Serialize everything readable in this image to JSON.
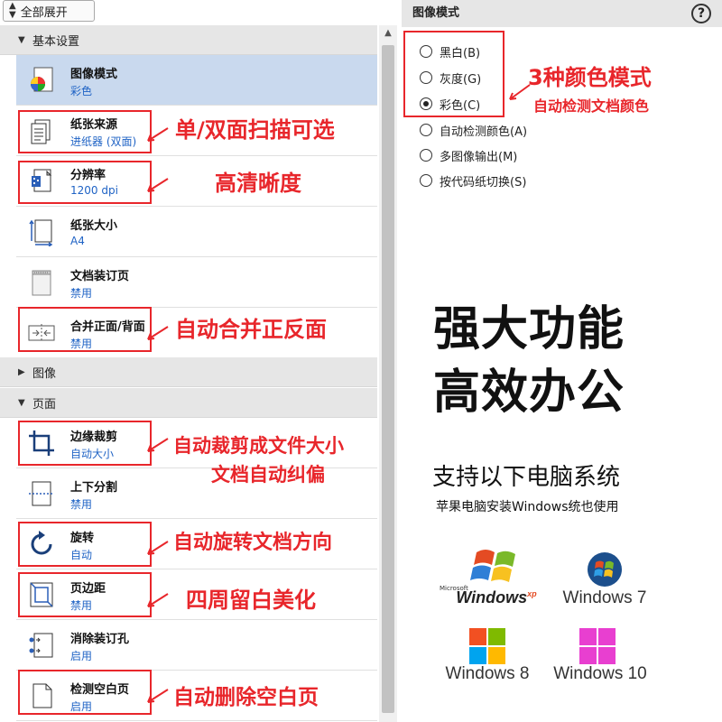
{
  "toolbar": {
    "expand_all": "全部展开"
  },
  "sections": {
    "basic": "基本设置",
    "image": "图像",
    "page": "页面"
  },
  "items": [
    {
      "name": "图像模式",
      "value": "彩色",
      "icon": "color-wheel-icon"
    },
    {
      "name": "纸张来源",
      "value": "进纸器 (双面)",
      "icon": "paper-source-icon"
    },
    {
      "name": "分辨率",
      "value": "1200 dpi",
      "icon": "resolution-icon"
    },
    {
      "name": "纸张大小",
      "value": "A4",
      "icon": "paper-size-icon"
    },
    {
      "name": "文档装订页",
      "value": "禁用",
      "icon": "binding-page-icon"
    },
    {
      "name": "合并正面/背面",
      "value": "禁用",
      "icon": "merge-sides-icon"
    },
    {
      "name": "边缘裁剪",
      "value": "自动大小",
      "icon": "crop-icon"
    },
    {
      "name": "上下分割",
      "value": "禁用",
      "icon": "split-icon"
    },
    {
      "name": "旋转",
      "value": "自动",
      "icon": "rotate-icon"
    },
    {
      "name": "页边距",
      "value": "禁用",
      "icon": "margin-icon"
    },
    {
      "name": "消除装订孔",
      "value": "启用",
      "icon": "punch-hole-icon"
    },
    {
      "name": "检测空白页",
      "value": "启用",
      "icon": "blank-page-icon"
    }
  ],
  "annotations": {
    "duplex": "单/双面扫描可选",
    "hd": "高清晰度",
    "merge": "自动合并正反面",
    "crop1": "自动裁剪成文件大小",
    "crop2": "文档自动纠偏",
    "rotate": "自动旋转文档方向",
    "margin": "四周留白美化",
    "blank": "自动删除空白页",
    "modes": "3种颜色模式",
    "detect": "自动检测文档颜色"
  },
  "right_panel": {
    "title": "图像模式",
    "help": "?",
    "options": [
      {
        "label": "黑白(B)",
        "selected": false
      },
      {
        "label": "灰度(G)",
        "selected": false
      },
      {
        "label": "彩色(C)",
        "selected": true
      },
      {
        "label": "自动检测颜色(A)",
        "selected": false
      },
      {
        "label": "多图像输出(M)",
        "selected": false
      },
      {
        "label": "按代码纸切换(S)",
        "selected": false
      }
    ]
  },
  "promo": {
    "line1": "强大功能",
    "line2": "高效办公",
    "support": "支持以下电脑系统",
    "note": "苹果电脑安装Windows统也使用"
  },
  "os": {
    "xp": "Windows",
    "xp_sup": "xp",
    "xp_small": "Microsoft",
    "w7": "Windows 7",
    "w8": "Windows 8",
    "w10": "Windows 10"
  },
  "colors": {
    "accent_red": "#e8262b",
    "value_blue": "#1f63c5",
    "selected_bg": "#c9d9ee"
  }
}
